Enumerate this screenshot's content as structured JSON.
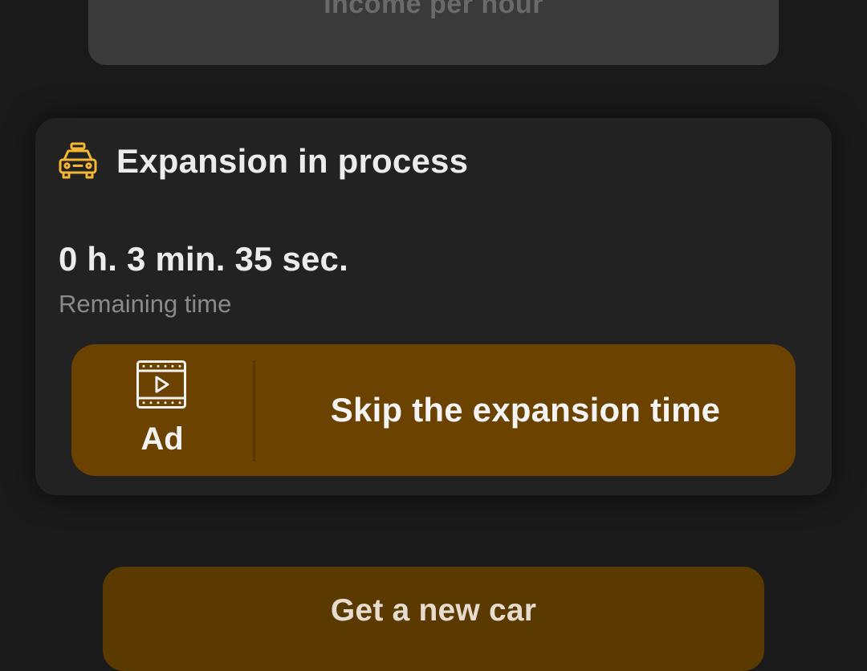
{
  "top_card": {
    "label": "Income per hour"
  },
  "expansion": {
    "icon": "taxi-icon",
    "title": "Expansion in process",
    "timer_value": "0 h. 3 min. 35 sec.",
    "timer_caption": "Remaining time",
    "skip_button": {
      "ad_icon": "film-play-icon",
      "ad_label": "Ad",
      "label": "Skip the expansion time"
    }
  },
  "new_car_button": {
    "label": "Get a new car"
  },
  "colors": {
    "background": "#1a1a1a",
    "card": "#222222",
    "accent_icon": "#f5b731",
    "skip_button": "#6b4200",
    "new_car_button": "#5a3a00"
  }
}
